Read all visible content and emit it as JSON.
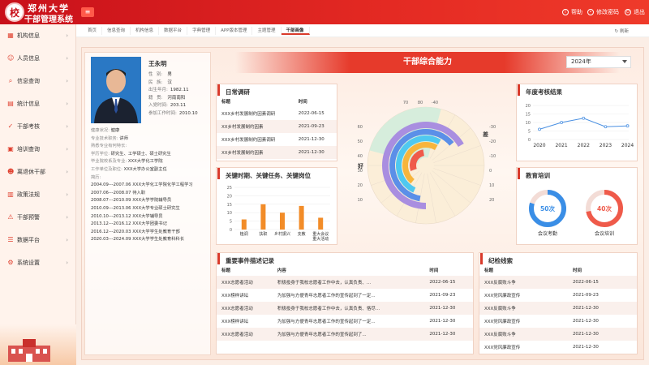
{
  "app": {
    "brand_line1": "郑州大学",
    "brand_line2": "干部管理系统",
    "help": "帮助",
    "change_pwd": "修改密码",
    "logout": "退出"
  },
  "sidebar": {
    "items": [
      {
        "label": "机构信息",
        "icon": "building-icon"
      },
      {
        "label": "人员信息",
        "icon": "person-icon"
      },
      {
        "label": "信息查询",
        "icon": "search-icon"
      },
      {
        "label": "统计信息",
        "icon": "chart-icon"
      },
      {
        "label": "干部考核",
        "icon": "check-icon"
      },
      {
        "label": "培训查询",
        "icon": "book-icon"
      },
      {
        "label": "离退休干部",
        "icon": "user-icon"
      },
      {
        "label": "政策法规",
        "icon": "doc-icon"
      },
      {
        "label": "干部预警",
        "icon": "alert-icon"
      },
      {
        "label": "数据平台",
        "icon": "database-icon"
      },
      {
        "label": "系统设置",
        "icon": "gear-icon"
      }
    ]
  },
  "tabs": [
    {
      "label": "首页"
    },
    {
      "label": "信息查询"
    },
    {
      "label": "机构信息"
    },
    {
      "label": "数据平台"
    },
    {
      "label": "字典管理"
    },
    {
      "label": "APP版本管理"
    },
    {
      "label": "主题管理"
    },
    {
      "label": "干部画像"
    }
  ],
  "refresh_label": "刷新",
  "profile": {
    "name": "王永明",
    "fields": [
      {
        "k": "性",
        "v": "男",
        "k2": "别:"
      },
      {
        "k": "民",
        "v": "汉",
        "k2": "族:"
      },
      {
        "k": "出生年月:",
        "v": "1982.11"
      },
      {
        "k": "籍",
        "v": "河南南阳",
        "k2": "贯:"
      },
      {
        "k": "入党时间:",
        "v": "203.11"
      },
      {
        "k": "参加工作时间:",
        "v": "2010.10"
      }
    ],
    "health_k": "健康状况:",
    "health_v": "健康",
    "tech_k": "专业技术职务:",
    "tech_v": "讲师",
    "skill_k": "熟悉专业有何特长:",
    "skill_v": "",
    "edu_k": "学历学位:",
    "edu_v": "研究生、工学硕士、硕士研究生",
    "school_k": "毕业院校系及专业:",
    "school_v": "XXX大学化工学院",
    "unit_k": "工作单位及职位:",
    "unit_v": "XXX大学办公室副主任",
    "resume_k": "简历:",
    "resume": [
      "2004.09---2007.06  XXX大学化工学院化学工程学习",
      "2007.06---2008.07  待入职",
      "2008.07---2010.09  XXX大学学院辅导员",
      "2010.09---2013.06  XXX大学专业硕士研究生",
      "2010.10---2013.12  XXX大学辅导员",
      "2013.12---2016.12  XXX大学团委书记",
      "2016.12---2020.03  XXX大学学生处教育干部",
      "2020.03---2024.09  XXX大学学生处教育科科长"
    ]
  },
  "header": {
    "title": "干部综合能力",
    "year": "2024年"
  },
  "daily": {
    "title": "日常调研",
    "cols": [
      "标题",
      "时间"
    ],
    "rows": [
      [
        "XXX乡村发展制约因素调研",
        "2022-06-15"
      ],
      [
        "XX乡村发展制约因素",
        "2021-09-23"
      ],
      [
        "XXX乡村发展制约因素调研",
        "2021-12-30"
      ],
      [
        "XX乡村发展制约因素",
        "2021-12-30"
      ]
    ]
  },
  "key": {
    "title": "关键时期、关键任务、关键岗位",
    "chart_data": {
      "type": "bar",
      "categories": [
        "植调",
        "扶职",
        "乡村振兴",
        "支教",
        "重大会议重大活动"
      ],
      "values": [
        6,
        15,
        10,
        14,
        7
      ],
      "ylim": [
        0,
        25
      ],
      "yticks": [
        "0",
        "5",
        "10",
        "15",
        "20",
        "25"
      ],
      "color": "#f28c28"
    }
  },
  "radar": {
    "label_good": "好",
    "label_bad": "差",
    "ticks_top": [
      "70",
      "80",
      "-40"
    ],
    "ticks_right": [
      "-30",
      "-20",
      "-10",
      "0",
      "10",
      "20"
    ],
    "ticks_left": [
      "60",
      "50",
      "40",
      "30",
      "20",
      "10"
    ],
    "colors": [
      "#a98ee0",
      "#5b8fe8",
      "#4fc8f0",
      "#f7b53c",
      "#ef5a4a"
    ]
  },
  "annual": {
    "title": "年度考核结果",
    "chart_data": {
      "type": "line",
      "categories": [
        "2020",
        "2021",
        "2022",
        "2023",
        "2024"
      ],
      "values": [
        6,
        10,
        12.5,
        7.5,
        8
      ],
      "ylim": [
        0,
        20
      ],
      "yticks": [
        "0",
        "5",
        "10",
        "15",
        "20"
      ],
      "color": "#4a90e2"
    }
  },
  "training": {
    "title": "教育培训",
    "items": [
      {
        "value": "50次",
        "label": "会议考勤",
        "color": "#3a8ee6",
        "fill": 0.8
      },
      {
        "value": "40次",
        "label": "会议培训",
        "color": "#ef5a4a",
        "fill": 0.72
      }
    ]
  },
  "events": {
    "title": "重要事件描述记录",
    "cols": [
      "标题",
      "内容",
      "时间"
    ],
    "rows": [
      [
        "XXX志愿者活动",
        "积极投身于我校志愿者工作中去，认真负责、...",
        "2022-06-15"
      ],
      [
        "XXX榜样讲坛",
        "为加强与方便青年志愿者工作的宣传起到了一定...",
        "2021-09-23"
      ],
      [
        "XXX志愿者活动",
        "积极投身于我校志愿者工作中去，认真负责、恪尽...",
        "2021-12-30"
      ],
      [
        "XXX榜样讲坛",
        "为加强与方便青年志愿者工作的宣传起到了一定...",
        "2021-12-30"
      ],
      [
        "XXX志愿者活动",
        "为加强与方便青年志愿者工作的宣传起到了...",
        "2021-12-30"
      ]
    ]
  },
  "discipline": {
    "title": "纪检线索",
    "cols": [
      "标题",
      "时间"
    ],
    "rows": [
      [
        "XXX反腐败斗争",
        "2022-06-15"
      ],
      [
        "XXX党风廉政宣传",
        "2021-09-23"
      ],
      [
        "XXX反腐败斗争",
        "2021-12-30"
      ],
      [
        "XXX党风廉政宣传",
        "2021-12-30"
      ],
      [
        "XXX反腐败斗争",
        "2021-12-30"
      ],
      [
        "XXX党风廉政宣传",
        "2021-12-30"
      ]
    ]
  }
}
